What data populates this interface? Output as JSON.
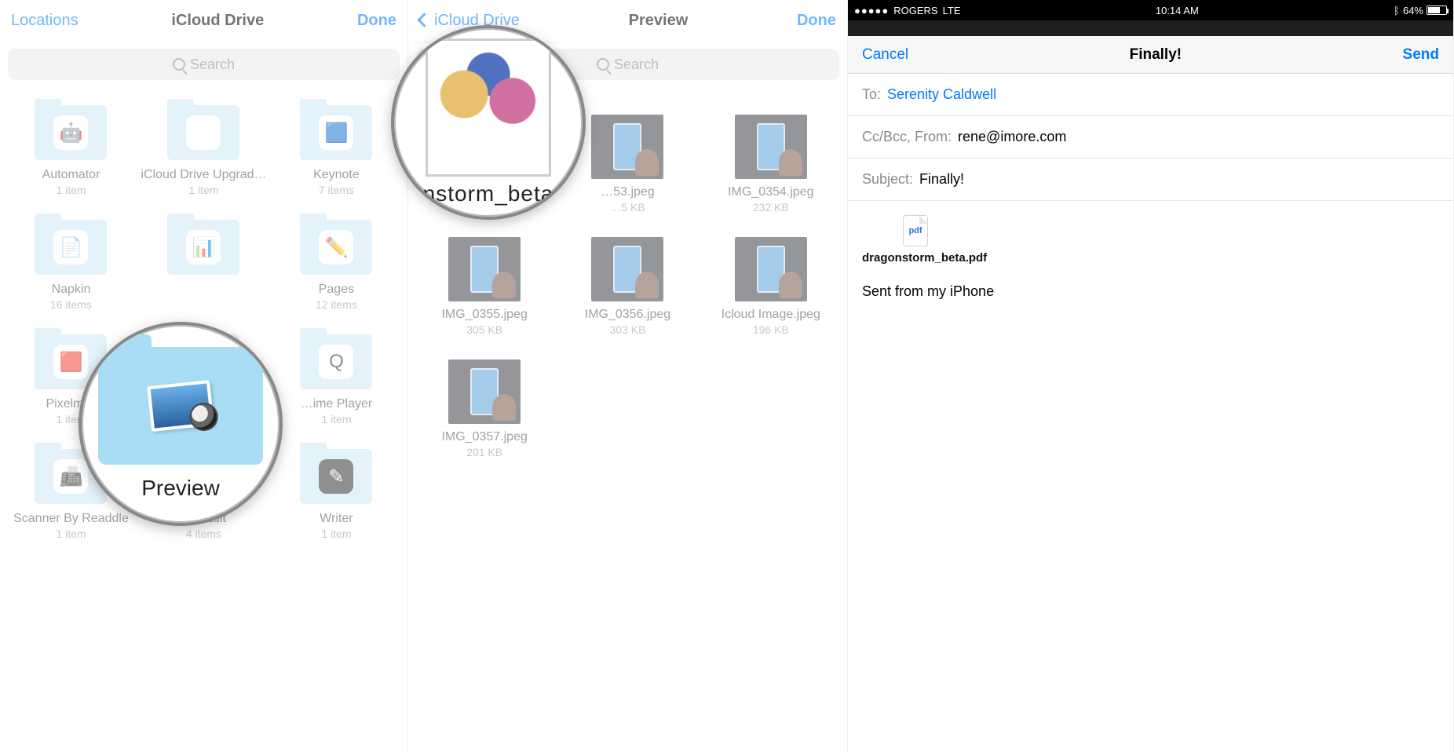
{
  "panel1": {
    "nav": {
      "left": "Locations",
      "title": "iCloud Drive",
      "right": "Done"
    },
    "search_placeholder": "Search",
    "folders": [
      {
        "name": "Automator",
        "sub": "1 item",
        "icon": "🤖",
        "bg": "#e8eef2"
      },
      {
        "name": "iCloud Drive Upgrad…",
        "sub": "1 item",
        "icon": "",
        "bg": "#cde7f7"
      },
      {
        "name": "Keynote",
        "sub": "7 items",
        "icon": "🟦",
        "bg": "#cde7f7"
      },
      {
        "name": "Napkin",
        "sub": "16 items",
        "icon": "📄",
        "bg": "#cde7f7"
      },
      {
        "name": "",
        "sub": "",
        "icon": "📊",
        "bg": "#cde7f7"
      },
      {
        "name": "Pages",
        "sub": "12 items",
        "icon": "✏️",
        "bg": "#ffb020"
      },
      {
        "name": "Pixelm…",
        "sub": "1 item",
        "icon": "🟥",
        "bg": "#cde7f7"
      },
      {
        "name": "",
        "sub": "",
        "icon": "",
        "bg": "#cde7f7"
      },
      {
        "name": "…ime Player",
        "sub": "1 item",
        "icon": "Q",
        "bg": "#cde7f7"
      },
      {
        "name": "Scanner By Readdle",
        "sub": "1 item",
        "icon": "📠",
        "bg": "#cde7f7"
      },
      {
        "name": "TextEdit",
        "sub": "4 items",
        "icon": "📝",
        "bg": "#cde7f7"
      },
      {
        "name": "Writer",
        "sub": "1 item",
        "icon": "✎",
        "bg": "#333"
      }
    ],
    "magnifier_label": "Preview"
  },
  "panel2": {
    "nav": {
      "back": "iCloud Drive",
      "title": "Preview",
      "right": "Done"
    },
    "search_placeholder": "Search",
    "files": [
      {
        "name": "…53.jpeg",
        "sub": "…5 KB"
      },
      {
        "name": "IMG_0354.jpeg",
        "sub": "232 KB"
      },
      {
        "name": "IMG_0355.jpeg",
        "sub": "305 KB"
      },
      {
        "name": "IMG_0356.jpeg",
        "sub": "303 KB"
      },
      {
        "name": "Icloud Image.jpeg",
        "sub": "196 KB"
      },
      {
        "name": "IMG_0357.jpeg",
        "sub": "201 KB"
      }
    ],
    "magnifier_label": "nstorm_beta"
  },
  "panel3": {
    "status": {
      "carrier": "ROGERS",
      "net": "LTE",
      "time": "10:14 AM",
      "bt": "✱",
      "batt_text": "64%"
    },
    "bar": {
      "cancel": "Cancel",
      "title": "Finally!",
      "send": "Send"
    },
    "to_label": "To:",
    "to_value": "Serenity Caldwell",
    "ccbcc_label": "Cc/Bcc, From:",
    "ccbcc_value": "rene@imore.com",
    "subject_label": "Subject:",
    "subject_value": "Finally!",
    "attach_ext": "pdf",
    "attach_name": "dragonstorm_beta.pdf",
    "signature": "Sent from my iPhone"
  }
}
